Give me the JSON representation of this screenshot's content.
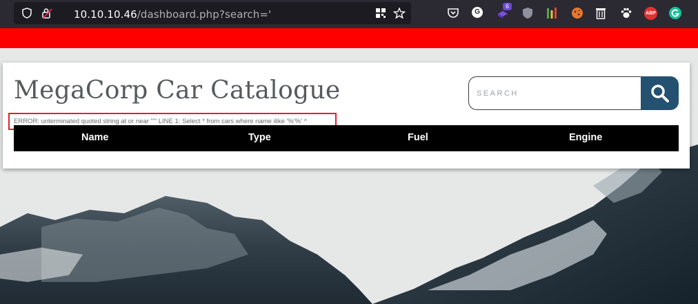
{
  "browser": {
    "url_host": "10.10.10.46",
    "url_path": "/dashboard.php?search='",
    "extension_badge": "6",
    "ext_labels": {
      "grammarly_g": "G",
      "abp": "ABP"
    }
  },
  "colors": {
    "top_banner": "#fe0000",
    "search_button": "#24516f",
    "table_header": "#000000",
    "error_highlight": "#e0202a"
  },
  "page": {
    "title": "MegaCorp Car Catalogue",
    "search": {
      "placeholder": "SEARCH",
      "value": ""
    },
    "error_message": "ERROR: unterminated quoted string at or near \"'\" LINE 1: Select * from cars where name ilike '%'%' ^",
    "table": {
      "columns": [
        "Name",
        "Type",
        "Fuel",
        "Engine"
      ]
    }
  },
  "icons": [
    "shield-icon",
    "lock-warning-icon",
    "qr-code-icon",
    "bookmark-star-icon",
    "pocket-icon",
    "grammarly-icon",
    "extension-badge-icon",
    "privacy-shield-icon",
    "equalizer-icon",
    "cookie-icon",
    "trash-icon",
    "paw-icon",
    "adblock-plus-icon",
    "grammar-check-icon",
    "search-icon"
  ]
}
